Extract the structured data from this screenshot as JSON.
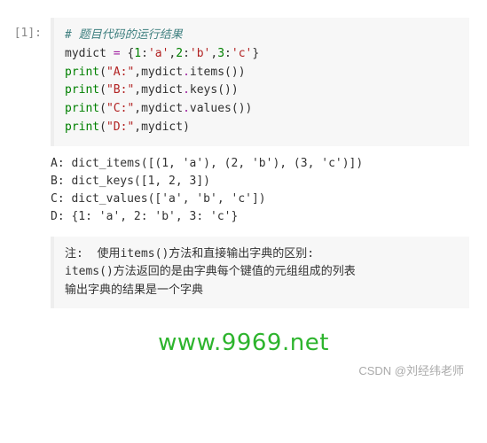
{
  "prompt": "[1]:",
  "code": {
    "l1_comment": "# 题目代码的运行结果",
    "l2": {
      "a": "mydict ",
      "op": "=",
      "b": " {",
      "n1": "1",
      "c1": ":",
      "s1": "'a'",
      "c2": ",",
      "n2": "2",
      "c3": ":",
      "s2": "'b'",
      "c4": ",",
      "n3": "3",
      "c5": ":",
      "s3": "'c'",
      "rb": "}"
    },
    "l3": {
      "p": "print",
      "lp": "(",
      "s": "\"A:\"",
      "cm": ",",
      "var": "mydict",
      "dot": ".",
      "m": "items",
      "pp": "())"
    },
    "l4": {
      "p": "print",
      "lp": "(",
      "s": "\"B:\"",
      "cm": ",",
      "var": "mydict",
      "dot": ".",
      "m": "keys",
      "pp": "())"
    },
    "l5": {
      "p": "print",
      "lp": "(",
      "s": "\"C:\"",
      "cm": ",",
      "var": "mydict",
      "dot": ".",
      "m": "values",
      "pp": "())"
    },
    "l6": {
      "p": "print",
      "lp": "(",
      "s": "\"D:\"",
      "cm": ",",
      "var": "mydict",
      "rp": ")"
    }
  },
  "output": {
    "l1": "A: dict_items([(1, 'a'), (2, 'b'), (3, 'c')])",
    "l2": "B: dict_keys([1, 2, 3])",
    "l3": "C: dict_values(['a', 'b', 'c'])",
    "l4": "D: {1: 'a', 2: 'b', 3: 'c'}"
  },
  "note": {
    "l1": "注:  使用items()方法和直接输出字典的区别:",
    "l2": "items()方法返回的是由字典每个键值的元组组成的列表",
    "l3": "输出字典的结果是一个字典"
  },
  "watermark": "www.9969.net",
  "credit": "CSDN @刘经纬老师"
}
